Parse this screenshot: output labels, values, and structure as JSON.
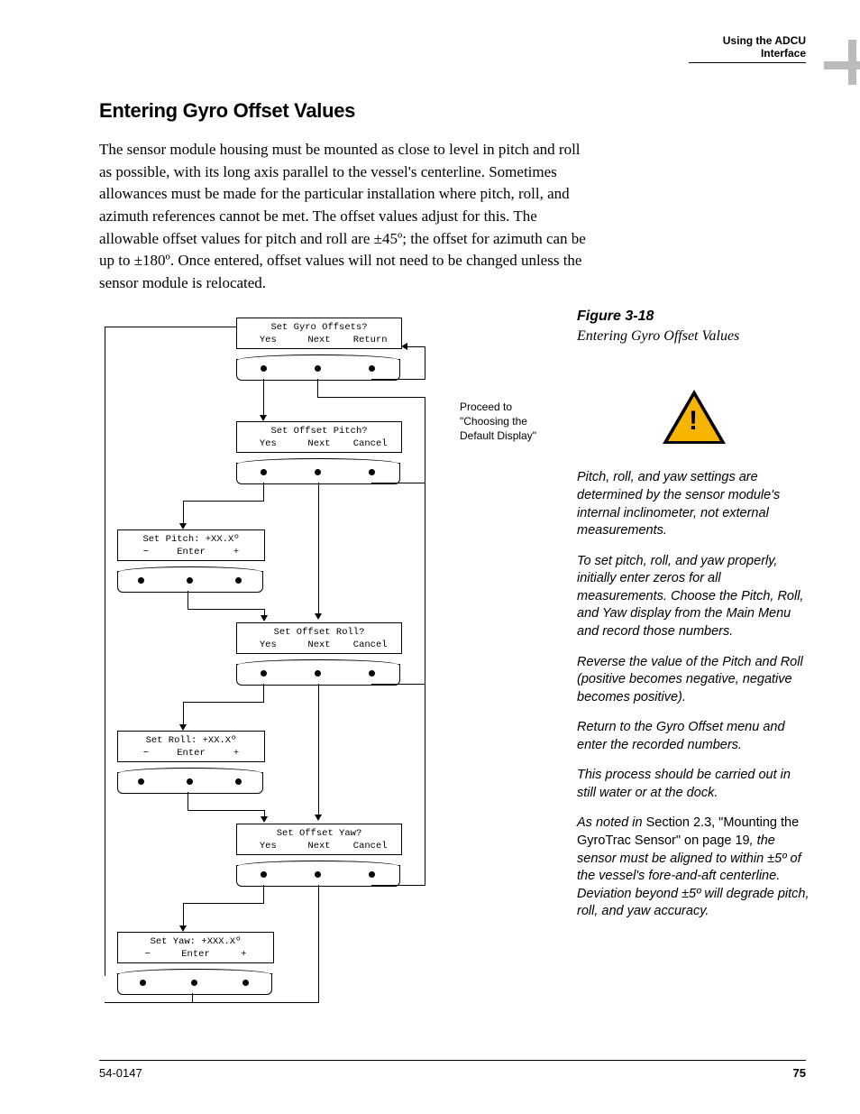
{
  "header": {
    "section": "Using the ADCU Interface"
  },
  "title": "Entering Gyro Offset Values",
  "paragraph": "The sensor module housing must be mounted as close to level in pitch and roll as possible, with its long axis parallel to the vessel's centerline. Sometimes allowances must be made for the particular installation where pitch, roll, and azimuth references cannot be met. The offset values adjust for this. The allowable offset values for pitch and roll are ±45º; the offset for azimuth can be up to ±180º. Once entered, offset values will not need to be changed unless the sensor module is relocated.",
  "figure": {
    "label": "Figure 3-18",
    "caption": "Entering Gyro Offset Values"
  },
  "sidebar": {
    "p1": "Pitch, roll, and yaw settings are determined by the sensor module's internal inclinometer, not external measurements.",
    "p2": "To set pitch, roll, and yaw properly, initially enter zeros for all measurements. Choose the Pitch, Roll, and Yaw display from the Main Menu and record those numbers.",
    "p3": "Reverse the value of the Pitch and Roll (positive becomes negative, negative becomes positive).",
    "p4": "Return to the Gyro Offset menu and enter the recorded numbers.",
    "p5": "This process should be carried out in still water or at the dock.",
    "p6a": "As noted in ",
    "p6b": "Section 2.3, \"Mounting the GyroTrac Sensor\" on page 19",
    "p6c": ", the sensor must be aligned to within ±5º of the vessel's fore-and-aft centerline. Deviation beyond ±5º will degrade pitch, roll, and yaw accuracy."
  },
  "flow": {
    "callout": "Proceed to \"Choosing the Default Display\"",
    "b1": {
      "t": "Set Gyro Offsets?",
      "l": "Yes",
      "m": "Next",
      "r": "Return"
    },
    "b2": {
      "t": "Set Offset Pitch?",
      "l": "Yes",
      "m": "Next",
      "r": "Cancel"
    },
    "b3": {
      "t": "Set Pitch: +XX.Xº",
      "l": "−",
      "m": "Enter",
      "r": "+"
    },
    "b4": {
      "t": "Set Offset Roll?",
      "l": "Yes",
      "m": "Next",
      "r": "Cancel"
    },
    "b5": {
      "t": "Set Roll: +XX.Xº",
      "l": "−",
      "m": "Enter",
      "r": "+"
    },
    "b6": {
      "t": "Set Offset Yaw?",
      "l": "Yes",
      "m": "Next",
      "r": "Cancel"
    },
    "b7": {
      "t": "Set Yaw: +XXX.Xº",
      "l": "−",
      "m": "Enter",
      "r": "+"
    }
  },
  "footer": {
    "docnum": "54-0147",
    "page": "75"
  }
}
